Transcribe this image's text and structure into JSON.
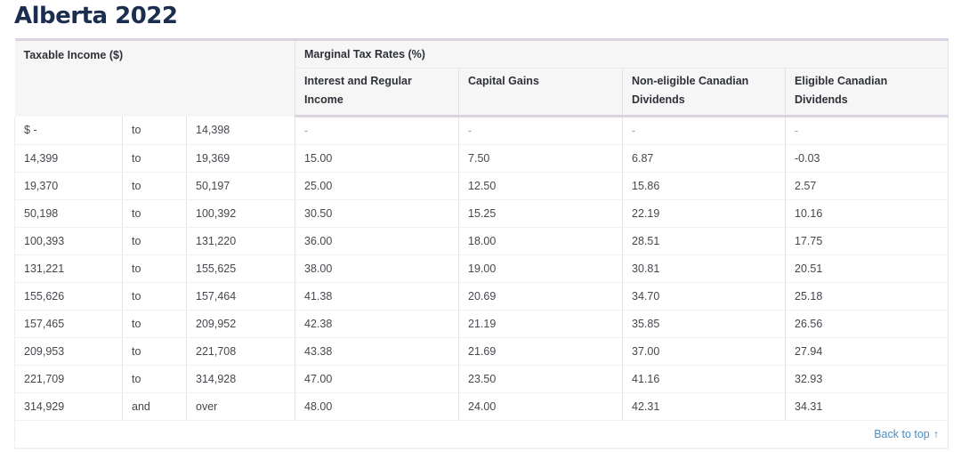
{
  "title": "Alberta 2022",
  "headers": {
    "taxable_income": "Taxable Income ($)",
    "marginal_rates": "Marginal Tax Rates (%)",
    "columns": [
      "Interest and Regular Income",
      "Capital Gains",
      "Non-eligible Canadian Dividends",
      "Eligible Canadian Dividends"
    ]
  },
  "rows": [
    {
      "from": "$ -",
      "sep": "to",
      "to": "14,398",
      "interest": "-",
      "capital_gains": "-",
      "non_eligible": "-",
      "eligible": "-"
    },
    {
      "from": "14,399",
      "sep": "to",
      "to": "19,369",
      "interest": "15.00",
      "capital_gains": "7.50",
      "non_eligible": "6.87",
      "eligible": "-0.03"
    },
    {
      "from": "19,370",
      "sep": "to",
      "to": "50,197",
      "interest": "25.00",
      "capital_gains": "12.50",
      "non_eligible": "15.86",
      "eligible": "2.57"
    },
    {
      "from": "50,198",
      "sep": "to",
      "to": "100,392",
      "interest": "30.50",
      "capital_gains": "15.25",
      "non_eligible": "22.19",
      "eligible": "10.16"
    },
    {
      "from": "100,393",
      "sep": "to",
      "to": "131,220",
      "interest": "36.00",
      "capital_gains": "18.00",
      "non_eligible": "28.51",
      "eligible": "17.75"
    },
    {
      "from": "131,221",
      "sep": "to",
      "to": "155,625",
      "interest": "38.00",
      "capital_gains": "19.00",
      "non_eligible": "30.81",
      "eligible": "20.51"
    },
    {
      "from": "155,626",
      "sep": "to",
      "to": "157,464",
      "interest": "41.38",
      "capital_gains": "20.69",
      "non_eligible": "34.70",
      "eligible": "25.18"
    },
    {
      "from": "157,465",
      "sep": "to",
      "to": "209,952",
      "interest": "42.38",
      "capital_gains": "21.19",
      "non_eligible": "35.85",
      "eligible": "26.56"
    },
    {
      "from": "209,953",
      "sep": "to",
      "to": "221,708",
      "interest": "43.38",
      "capital_gains": "21.69",
      "non_eligible": "37.00",
      "eligible": "27.94"
    },
    {
      "from": "221,709",
      "sep": "to",
      "to": "314,928",
      "interest": "47.00",
      "capital_gains": "23.50",
      "non_eligible": "41.16",
      "eligible": "32.93"
    },
    {
      "from": "314,929",
      "sep": "and",
      "to": "over",
      "interest": "48.00",
      "capital_gains": "24.00",
      "non_eligible": "42.31",
      "eligible": "34.31"
    }
  ],
  "footer": {
    "back_to_top": "Back to top",
    "arrow_icon": "↑"
  },
  "colors": {
    "title": "#1b2e4f",
    "link": "#4a8cc1",
    "header_rule": "#dcd3e2"
  }
}
